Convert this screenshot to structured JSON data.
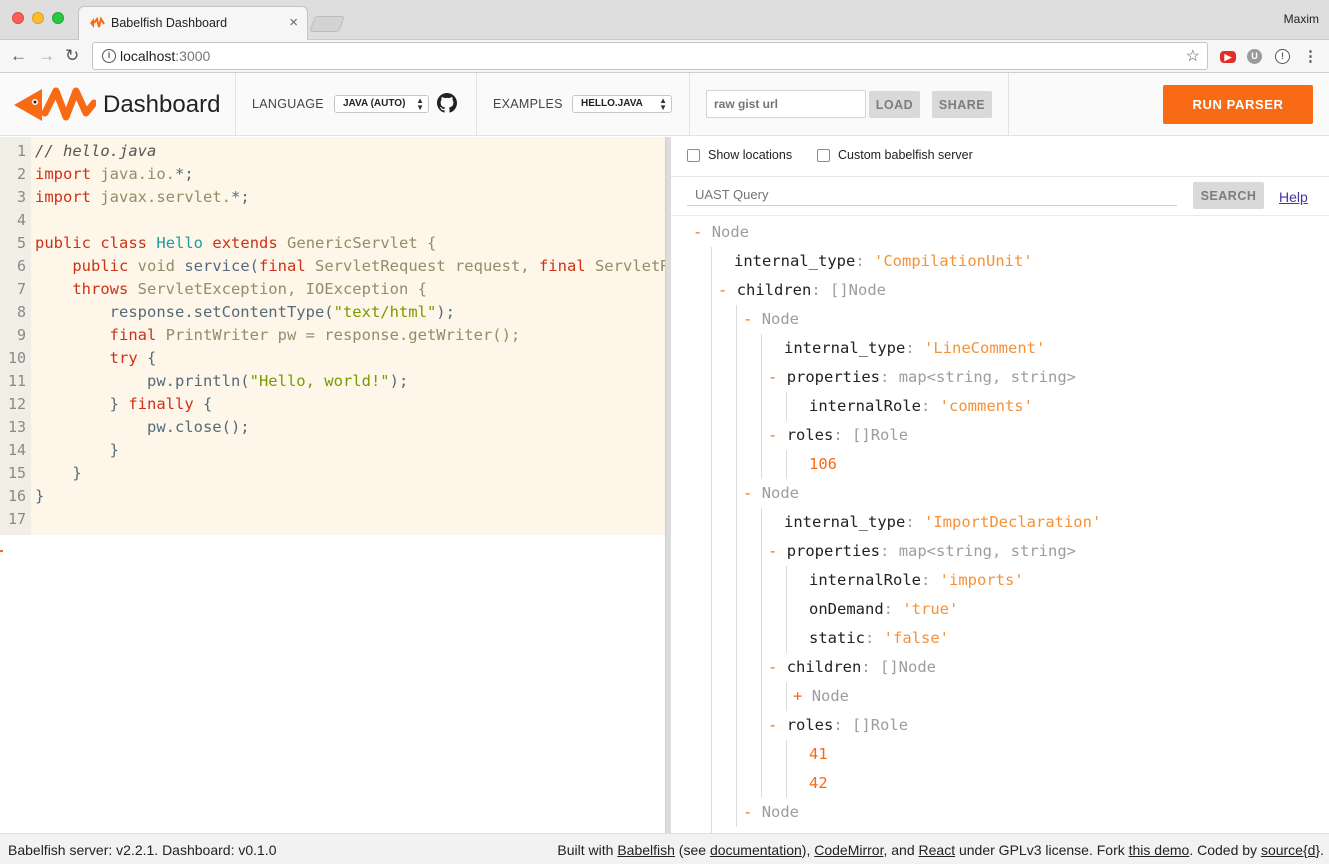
{
  "browser": {
    "tab_title": "Babelfish Dashboard",
    "tab_close": "×",
    "profile_name": "Maxim",
    "url_host": "localhost",
    "url_port": ":3000",
    "back": "←",
    "forward": "→",
    "reload": "↻",
    "star": "☆"
  },
  "header": {
    "brand": "Dashboard",
    "language_label": "LANGUAGE",
    "language_value": "JAVA (AUTO)",
    "examples_label": "EXAMPLES",
    "examples_value": "HELLO.JAVA",
    "gist_placeholder": "raw gist url",
    "load_label": "LOAD",
    "share_label": "SHARE",
    "run_label": "RUN PARSER",
    "accent_color": "#f96a15"
  },
  "editor": {
    "line_numbers": [
      "1",
      "2",
      "3",
      "4",
      "5",
      "6",
      "7",
      "8",
      "9",
      "10",
      "11",
      "12",
      "13",
      "14",
      "15",
      "16",
      "17"
    ],
    "lines": [
      [
        {
          "t": "// hello.java",
          "c": "cm"
        }
      ],
      [
        {
          "t": "import",
          "c": "kw"
        },
        {
          "t": " java.io.",
          "c": "ty"
        },
        {
          "t": "*",
          "c": "pl"
        },
        {
          "t": ";",
          "c": "pl"
        }
      ],
      [
        {
          "t": "import",
          "c": "kw"
        },
        {
          "t": " javax.servlet.",
          "c": "ty"
        },
        {
          "t": "*",
          "c": "pl"
        },
        {
          "t": ";",
          "c": "pl"
        }
      ],
      [],
      [
        {
          "t": "public",
          "c": "kw"
        },
        {
          "t": " ",
          "c": "pl"
        },
        {
          "t": "class",
          "c": "kw"
        },
        {
          "t": " ",
          "c": "pl"
        },
        {
          "t": "Hello",
          "c": "cls"
        },
        {
          "t": " ",
          "c": "pl"
        },
        {
          "t": "extends",
          "c": "kw"
        },
        {
          "t": " GenericServlet {",
          "c": "ty"
        }
      ],
      [
        {
          "t": "    ",
          "c": "pl"
        },
        {
          "t": "public",
          "c": "kw"
        },
        {
          "t": " ",
          "c": "pl"
        },
        {
          "t": "void",
          "c": "ty"
        },
        {
          "t": " service(",
          "c": "pl"
        },
        {
          "t": "final",
          "c": "kw"
        },
        {
          "t": " ServletRequest request, ",
          "c": "ty"
        },
        {
          "t": "final",
          "c": "kw"
        },
        {
          "t": " ServletResponse response)",
          "c": "ty"
        }
      ],
      [
        {
          "t": "    ",
          "c": "pl"
        },
        {
          "t": "throws",
          "c": "kw"
        },
        {
          "t": " ServletException, IOException {",
          "c": "ty"
        }
      ],
      [
        {
          "t": "        response.setContentType(",
          "c": "pl"
        },
        {
          "t": "\"text/html\"",
          "c": "str"
        },
        {
          "t": ");",
          "c": "pl"
        }
      ],
      [
        {
          "t": "        ",
          "c": "pl"
        },
        {
          "t": "final",
          "c": "kw"
        },
        {
          "t": " PrintWriter pw = response.getWriter();",
          "c": "ty"
        }
      ],
      [
        {
          "t": "        ",
          "c": "pl"
        },
        {
          "t": "try",
          "c": "kw"
        },
        {
          "t": " {",
          "c": "pl"
        }
      ],
      [
        {
          "t": "            pw.println(",
          "c": "pl"
        },
        {
          "t": "\"Hello, world!\"",
          "c": "str"
        },
        {
          "t": ");",
          "c": "pl"
        }
      ],
      [
        {
          "t": "        } ",
          "c": "pl"
        },
        {
          "t": "finally",
          "c": "kw"
        },
        {
          "t": " {",
          "c": "pl"
        }
      ],
      [
        {
          "t": "            pw.close();",
          "c": "pl"
        }
      ],
      [
        {
          "t": "        }",
          "c": "pl"
        }
      ],
      [
        {
          "t": "    }",
          "c": "pl"
        }
      ],
      [
        {
          "t": "}",
          "c": "pl"
        }
      ],
      []
    ]
  },
  "options": {
    "show_locations": "Show locations",
    "custom_server": "Custom babelfish server"
  },
  "query": {
    "placeholder": "UAST Query",
    "search_label": "SEARCH",
    "help_label": "Help"
  },
  "tree": [
    {
      "depth": 0,
      "toggle": "-",
      "label": "Node"
    },
    {
      "depth": 1,
      "key": "internal_type",
      "str": "'CompilationUnit'"
    },
    {
      "depth": 1,
      "toggle": "-",
      "key": "children",
      "type": "[]Node"
    },
    {
      "depth": 2,
      "toggle": "-",
      "label": "Node"
    },
    {
      "depth": 3,
      "key": "internal_type",
      "str": "'LineComment'"
    },
    {
      "depth": 3,
      "toggle": "-",
      "key": "properties",
      "type": "map<string, string>"
    },
    {
      "depth": 4,
      "key": "internalRole",
      "str": "'comments'"
    },
    {
      "depth": 3,
      "toggle": "-",
      "key": "roles",
      "type": "[]Role"
    },
    {
      "depth": 4,
      "num": "106"
    },
    {
      "depth": 2,
      "toggle": "-",
      "label": "Node"
    },
    {
      "depth": 3,
      "key": "internal_type",
      "str": "'ImportDeclaration'"
    },
    {
      "depth": 3,
      "toggle": "-",
      "key": "properties",
      "type": "map<string, string>"
    },
    {
      "depth": 4,
      "key": "internalRole",
      "str": "'imports'"
    },
    {
      "depth": 4,
      "key": "onDemand",
      "str": "'true'"
    },
    {
      "depth": 4,
      "key": "static",
      "str": "'false'"
    },
    {
      "depth": 3,
      "toggle": "-",
      "key": "children",
      "type": "[]Node"
    },
    {
      "depth": 4,
      "toggle": "+",
      "label": "Node"
    },
    {
      "depth": 3,
      "toggle": "-",
      "key": "roles",
      "type": "[]Role"
    },
    {
      "depth": 4,
      "num": "41"
    },
    {
      "depth": 4,
      "num": "42"
    },
    {
      "depth": 2,
      "toggle": "-",
      "label": "Node"
    }
  ],
  "footer": {
    "versions": "Babelfish server: v2.2.1. Dashboard: v0.1.0",
    "built_with": "Built with ",
    "babelfish_link": "Babelfish",
    "see": " (see ",
    "documentation_link": "documentation",
    "after_doc": "), ",
    "codemirror_link": "CodeMirror",
    "and": ", and ",
    "react_link": "React",
    "license": " under GPLv3 license. Fork ",
    "demo_link": "this demo",
    "coded_by": ". Coded by ",
    "source_link": "source{d}",
    "end": "."
  }
}
